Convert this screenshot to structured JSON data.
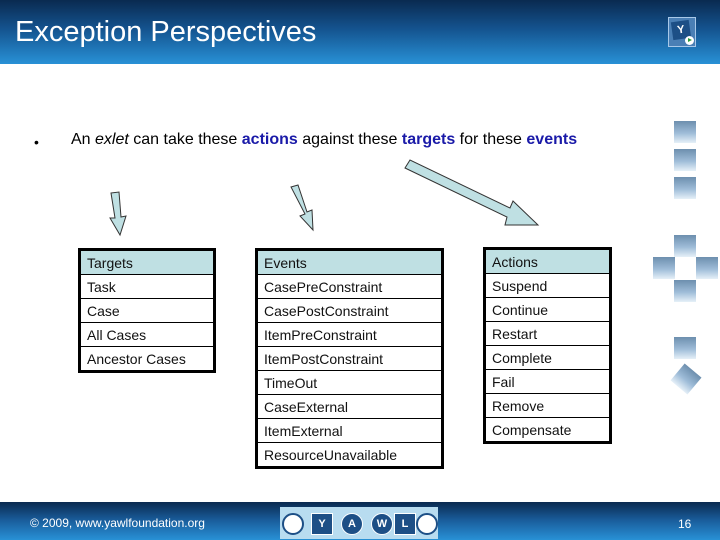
{
  "header": {
    "title": "Exception Perspectives",
    "logo_icon": "yawl-logo-icon"
  },
  "bullet": {
    "marker": "•",
    "parts": {
      "p1": "An ",
      "exlet": "exlet",
      "p2": " can take these ",
      "actions": "actions",
      "p3": " against these ",
      "targets": "targets",
      "p4": " for these ",
      "events": "events"
    }
  },
  "colors": {
    "header_dark": "#0a2a50",
    "header_light": "#2891d6",
    "keyword": "#1a1aa8",
    "table_header_bg": "#bfe0e3",
    "arrow_fill": "#bfe0e3"
  },
  "tables": {
    "targets": {
      "header": "Targets",
      "rows": [
        "Task",
        "Case",
        "All Cases",
        "Ancestor Cases"
      ]
    },
    "events": {
      "header": "Events",
      "rows": [
        "CasePreConstraint",
        "CasePostConstraint",
        "ItemPreConstraint",
        "ItemPostConstraint",
        "TimeOut",
        "CaseExternal",
        "ItemExternal",
        "ResourceUnavailable"
      ]
    },
    "actions": {
      "header": "Actions",
      "rows": [
        "Suspend",
        "Continue",
        "Restart",
        "Complete",
        "Fail",
        "Remove",
        "Compensate"
      ]
    }
  },
  "footer": {
    "copyright": "© 2009, www.yawlfoundation.org",
    "logo_letters": [
      "Y",
      "A",
      "W",
      "L"
    ],
    "page_number": "16"
  }
}
